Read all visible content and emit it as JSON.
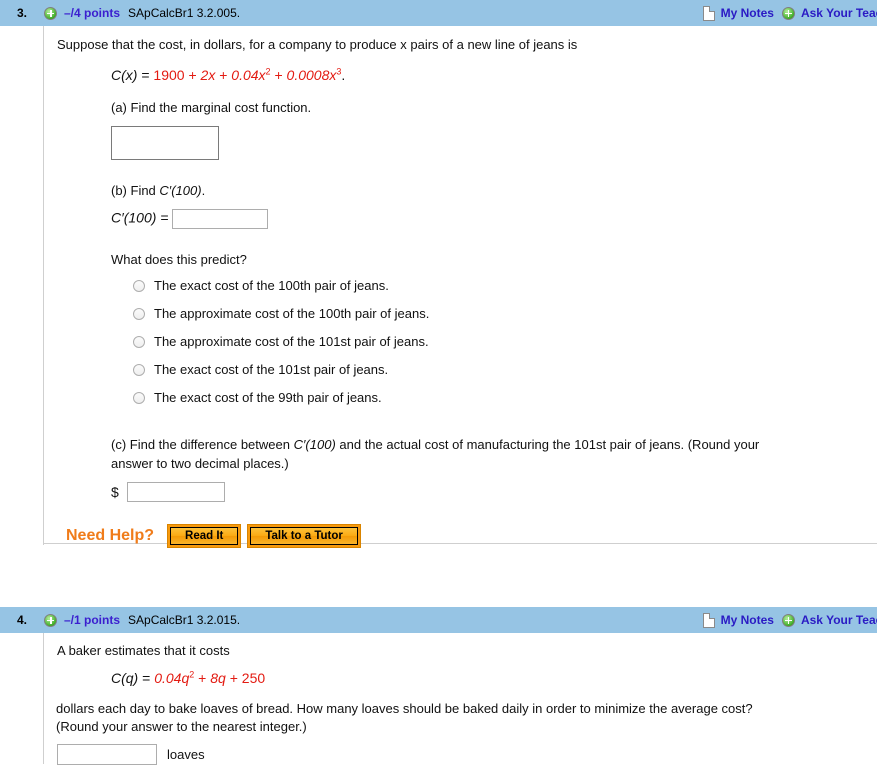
{
  "questions": [
    {
      "number": "3.",
      "points": "–/4 points",
      "key": "SApCalcBr1 3.2.005.",
      "my_notes": "My Notes",
      "ask_teacher": "Ask Your Teacher",
      "prompt": "Suppose that the cost, in dollars, for a company to produce x pairs of a new line of jeans is",
      "formula": {
        "lhs": "C(x)",
        "eq": "=",
        "t1": "1900",
        "op1": "+",
        "t2": "2x",
        "op2": "+",
        "t3": "0.04x",
        "t3_exp": "2",
        "op3": "+",
        "t4": "0.0008x",
        "t4_exp": "3",
        "period": "."
      },
      "part_a": {
        "label": "(a) Find the marginal cost function."
      },
      "part_b": {
        "label_pre": "(b) Find ",
        "label_math": "C′(100)",
        "label_post": ".",
        "answer_label": "C′(100)  =",
        "value": ""
      },
      "predict_question": "What does this predict?",
      "options": [
        "The exact cost of the 100th pair of jeans.",
        "The approximate cost of the 100th pair of jeans.",
        "The approximate cost of the 101st pair of jeans.",
        "The exact cost of the 101st pair of jeans.",
        "The exact cost of the 99th pair of jeans."
      ],
      "part_c": {
        "line1_pre": "(c) Find the difference between ",
        "line1_math": "C′(100)",
        "line1_post": " and the actual cost of manufacturing the 101st pair of jeans. (Round your",
        "line2": "answer to two decimal places.)",
        "currency": "$",
        "value": ""
      },
      "need_help": {
        "label": "Need Help?",
        "read_it": "Read It",
        "talk_tutor": "Talk to a Tutor"
      }
    },
    {
      "number": "4.",
      "points": "–/1 points",
      "key": "SApCalcBr1 3.2.015.",
      "my_notes": "My Notes",
      "ask_teacher": "Ask Your Teacher",
      "prompt": "A baker estimates that it costs",
      "formula": {
        "lhs": "C(q)",
        "eq": "=",
        "t1": "0.04q",
        "t1_exp": "2",
        "op1": "+",
        "t2": "8q",
        "op2": "+",
        "t3": "250"
      },
      "line1": "dollars each day to bake loaves of bread. How many loaves should be baked daily in order to minimize the average cost?",
      "line2": "(Round your answer to the nearest integer.)",
      "answer_value": "",
      "answer_unit": "loaves"
    }
  ],
  "colors": {
    "header_bg": "#96c4e4",
    "link_blue": "#2a1bc4",
    "points_purple": "#3b1fcf",
    "math_red": "#e31b12",
    "need_help_orange": "#f07c1a"
  }
}
